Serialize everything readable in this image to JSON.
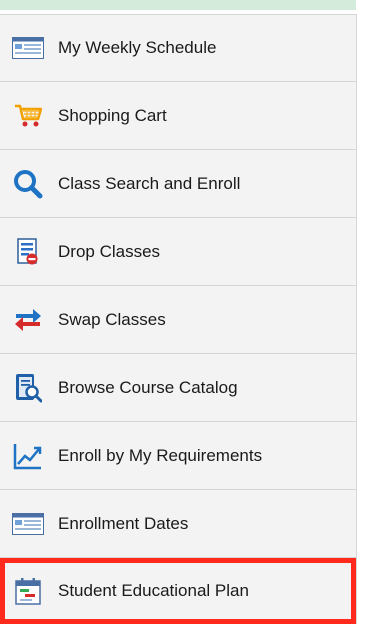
{
  "menu": {
    "items": [
      {
        "label": "My Weekly Schedule",
        "icon": "calendar-grid-icon"
      },
      {
        "label": "Shopping Cart",
        "icon": "shopping-cart-icon"
      },
      {
        "label": "Class Search and Enroll",
        "icon": "search-icon"
      },
      {
        "label": "Drop Classes",
        "icon": "drop-document-icon"
      },
      {
        "label": "Swap Classes",
        "icon": "swap-arrows-icon"
      },
      {
        "label": "Browse Course Catalog",
        "icon": "catalog-search-icon"
      },
      {
        "label": "Enroll by My Requirements",
        "icon": "trend-chart-icon"
      },
      {
        "label": "Enrollment Dates",
        "icon": "calendar-grid-icon"
      },
      {
        "label": "Student Educational Plan",
        "icon": "plan-calendar-icon"
      }
    ]
  },
  "colors": {
    "highlight_border": "#ff2a1c",
    "top_bar": "#d4ebdc",
    "item_background": "#f3f3f3"
  }
}
